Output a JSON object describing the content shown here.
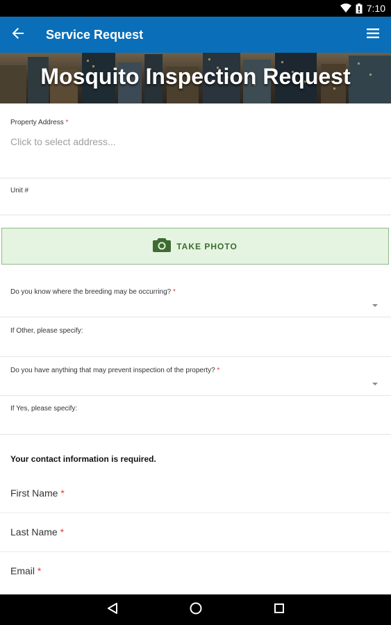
{
  "status_bar": {
    "time": "7:10"
  },
  "app_bar": {
    "title": "Service Request"
  },
  "banner": {
    "title": "Mosquito Inspection Request"
  },
  "form": {
    "property_address": {
      "label": "Property Address",
      "placeholder": "Click to select address..."
    },
    "unit": {
      "label": "Unit #"
    },
    "take_photo": {
      "label": "TAKE PHOTO"
    },
    "breeding": {
      "label": "Do you know where the breeding may be occurring?"
    },
    "other_specify": {
      "label": "If Other, please specify:"
    },
    "prevent_inspection": {
      "label": "Do you have anything that may prevent inspection of the property?"
    },
    "yes_specify": {
      "label": "If Yes, please specify:"
    },
    "contact_heading": "Your contact information is required.",
    "first_name": {
      "label": "First Name"
    },
    "last_name": {
      "label": "Last Name"
    },
    "email": {
      "label": "Email"
    },
    "required_marker": "*"
  },
  "icons": {
    "wifi": "wifi-icon",
    "battery": "battery-icon",
    "back": "arrow-left-icon",
    "menu": "hamburger-menu-icon",
    "camera": "camera-icon",
    "nav_back": "triangle-back-icon",
    "nav_home": "circle-home-icon",
    "nav_recent": "square-recents-icon"
  },
  "colors": {
    "app_bar": "#0a6fb8",
    "photo_button_bg": "#e4f4e0",
    "photo_button_text": "#3d6b31",
    "required": "#e53935"
  }
}
